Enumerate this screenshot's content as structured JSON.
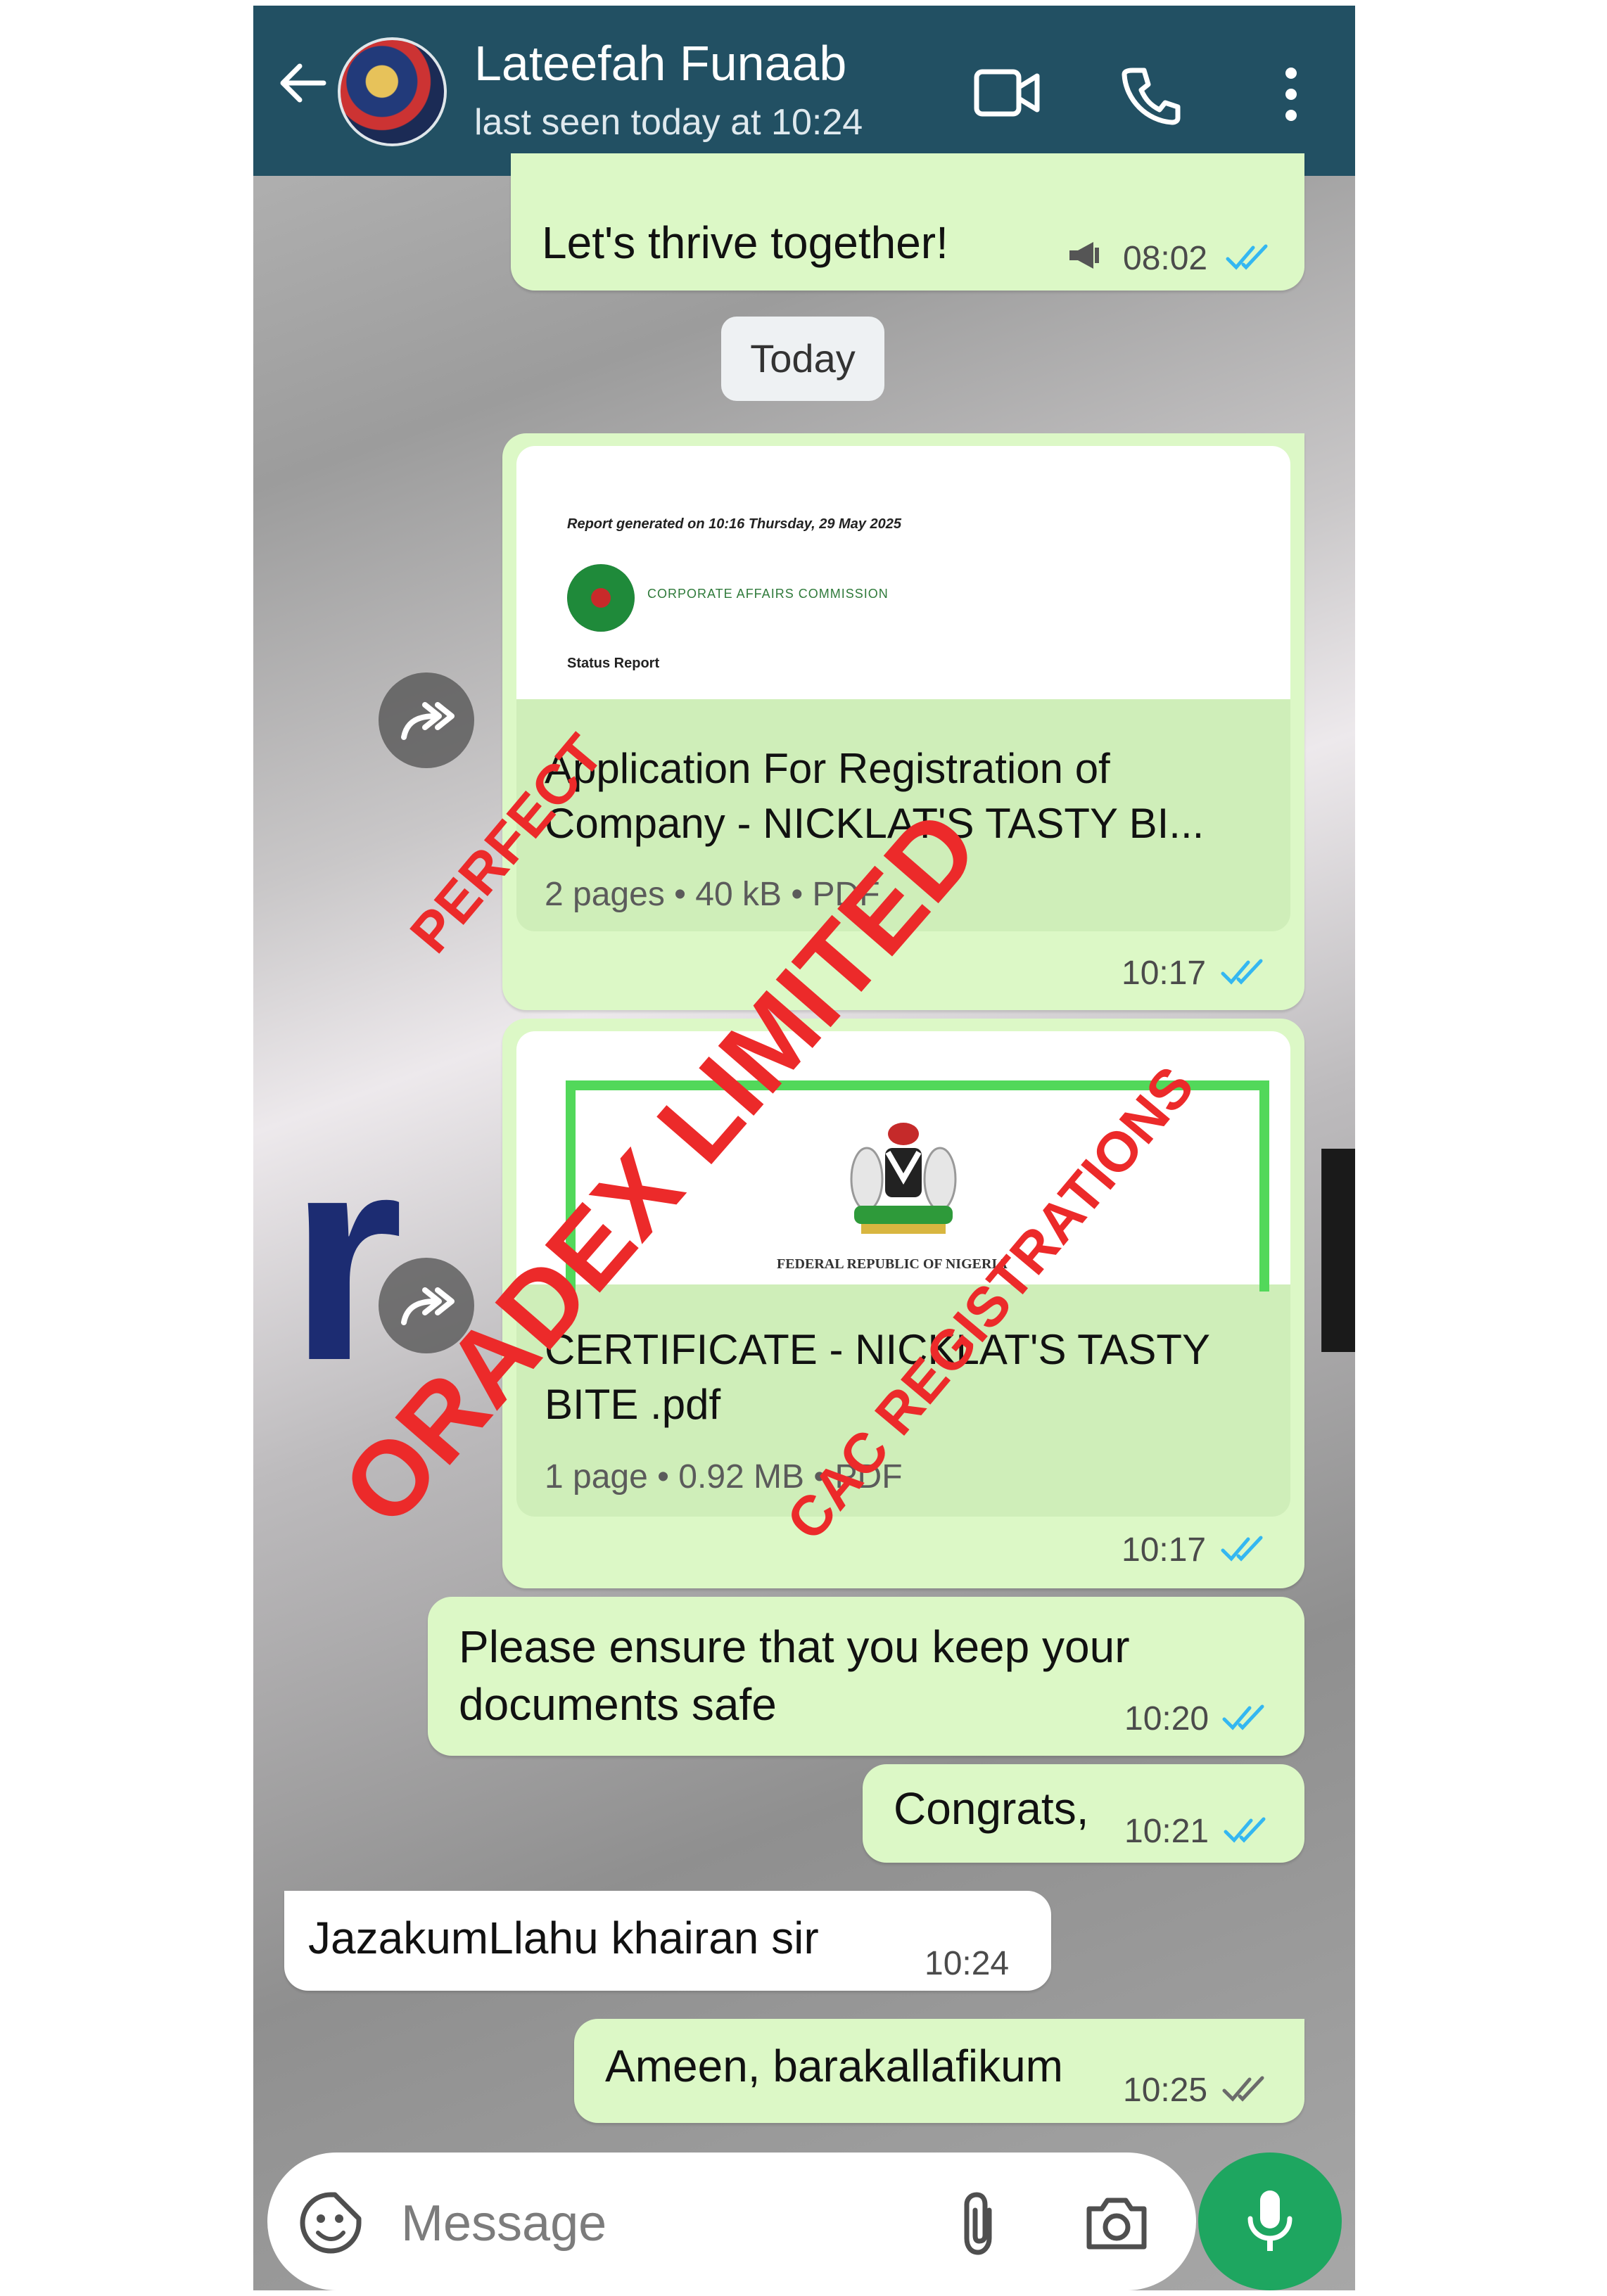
{
  "header": {
    "contact_name": "Lateefah Funaab",
    "last_seen": "last seen today at 10:24",
    "icons": [
      "back-arrow-icon",
      "avatar",
      "video-call-icon",
      "voice-call-icon",
      "more-options-icon"
    ]
  },
  "background_letters": {
    "left": "r",
    "right": "K"
  },
  "messages": [
    {
      "text": "Let's thrive together!",
      "time": "08:02",
      "status": "read"
    },
    {
      "date_chip": "Today"
    },
    {
      "document": {
        "preview_line1": "Report generated on 10:16 Thursday, 29 May 2025",
        "preview_logo_text": "CORPORATE AFFAIRS COMMISSION",
        "preview_line2": "Status Report",
        "name_line1": "Application For Registration of",
        "name_line2": "Company -  NICKLAT'S TASTY BI...",
        "meta": "2 pages • 40 kB • PDF"
      },
      "time": "10:17",
      "status": "read"
    },
    {
      "document": {
        "preview_caption": "FEDERAL REPUBLIC OF NIGERIA",
        "name_line1": "CERTIFICATE - NICKLAT'S TASTY",
        "name_line2": "BITE .pdf",
        "meta": "1 page • 0.92 MB • PDF"
      },
      "time": "10:17",
      "status": "read"
    },
    {
      "line1": "Please ensure that you keep your",
      "line2": "documents safe",
      "time": "10:20",
      "status": "read"
    },
    {
      "text": "Congrats,",
      "time": "10:21",
      "status": "read"
    },
    {
      "text": "JazakumLlahu khairan sir",
      "time": "10:24",
      "incoming": true
    },
    {
      "text": "Ameen, barakallafikum",
      "time": "10:25",
      "status": "delivered"
    }
  ],
  "watermarks": {
    "main": "ORADEX LIMITED",
    "top": "PERFECT",
    "bottom": "CAC REGISTRATIONS",
    "color": "#ec2a2a"
  },
  "input": {
    "placeholder": "Message",
    "icons": [
      "sticker-icon",
      "attach-icon",
      "camera-icon",
      "mic-icon"
    ]
  },
  "colors": {
    "header": "#225063",
    "outgoing_bubble": "#dcf8c6",
    "incoming_bubble": "#ffffff",
    "read_ticks": "#34b7f1",
    "mic_button": "#1ea660"
  }
}
